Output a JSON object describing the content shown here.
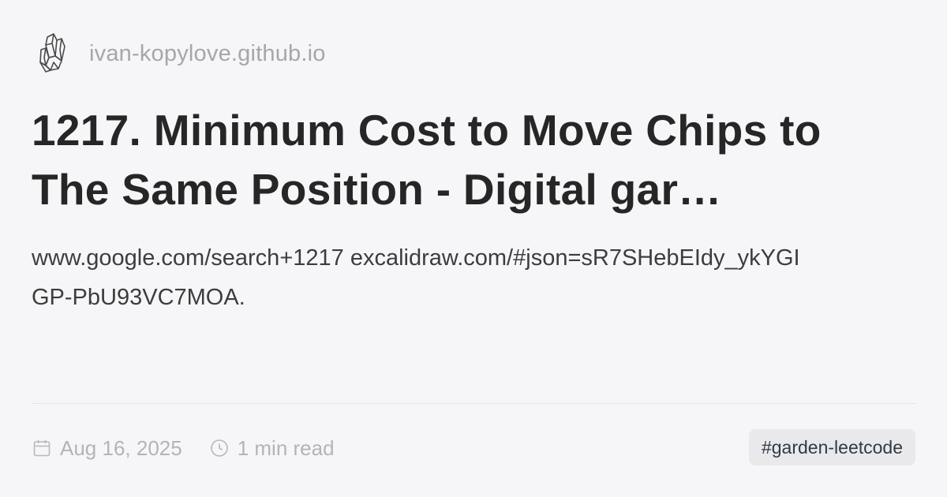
{
  "site": {
    "logo_icon": "crystal-logo-icon",
    "name": "ivan-kopylove.github.io"
  },
  "title": "1217. Minimum Cost to Move Chips to The Same Position - Digital gar…",
  "description": "www.google.com/search+1217 excalidraw.com/#json=sR7SHebEIdy_ykYGI\nGP-PbU93VC7MOA.",
  "meta": {
    "date_icon": "calendar-icon",
    "date": "Aug 16, 2025",
    "read_icon": "clock-icon",
    "read_time": "1 min read"
  },
  "tag": "#garden-leetcode",
  "colors": {
    "background": "#f6f6f8",
    "title": "#262626",
    "muted": "#a6a6ab",
    "tag_bg": "#e9e9ec",
    "tag_text": "#2f3a4a"
  }
}
